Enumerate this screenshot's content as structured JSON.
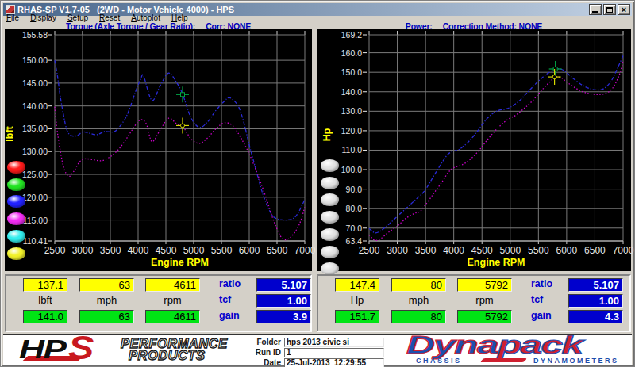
{
  "window": {
    "title": "RHAS-SP V1.7-05   (2WD - Motor Vehicle 4000) - HPS"
  },
  "menu": [
    "File",
    "Display",
    "Setup",
    "Reset",
    "Autoplot",
    "Help"
  ],
  "chart_data": [
    {
      "type": "line",
      "header": "Torque (Axle Torque / Gear Ratio):",
      "header_status": "Corr: NONE",
      "ylabel": "lbft",
      "xlabel": "Engine RPM",
      "xlim": [
        2500,
        7000
      ],
      "ylim": [
        110.41,
        155.58
      ],
      "x_ticks": [
        2500,
        3000,
        3500,
        4000,
        4500,
        5000,
        5500,
        6000,
        6500,
        7000
      ],
      "y_tick_values": [
        155.58,
        150,
        145,
        140,
        135,
        130,
        125,
        120,
        115,
        110.41
      ],
      "y_tick_labels": [
        "155.58",
        "150.00",
        "145.00",
        "140.00",
        "135.00",
        "130.00",
        "125.00",
        "120.00",
        "115.00",
        "110.41"
      ],
      "legend_colors": [
        "#ff1a1a",
        "#22e422",
        "#2222ff",
        "#f32df3",
        "#33eeee",
        "#f2f22a"
      ],
      "series": [
        {
          "name": "corrected-torque",
          "color": "#2a2ad8",
          "style": "dashdot",
          "points": [
            [
              2500,
              150.0
            ],
            [
              2550,
              146.5
            ],
            [
              2600,
              142.0
            ],
            [
              2700,
              135.5
            ],
            [
              2780,
              133.6
            ],
            [
              2900,
              133.5
            ],
            [
              3000,
              134.3
            ],
            [
              3100,
              134.1
            ],
            [
              3250,
              133.7
            ],
            [
              3400,
              134.4
            ],
            [
              3550,
              134.3
            ],
            [
              3650,
              135.2
            ],
            [
              3800,
              138.0
            ],
            [
              3950,
              143.0
            ],
            [
              4050,
              146.0
            ],
            [
              4100,
              146.5
            ],
            [
              4250,
              141.2
            ],
            [
              4400,
              144.5
            ],
            [
              4550,
              147.2
            ],
            [
              4700,
              145.0
            ],
            [
              4800,
              142.6
            ],
            [
              4950,
              137.5
            ],
            [
              5100,
              135.3
            ],
            [
              5250,
              136.5
            ],
            [
              5400,
              139.0
            ],
            [
              5550,
              141.0
            ],
            [
              5650,
              141.8
            ],
            [
              5800,
              140.0
            ],
            [
              5900,
              136.5
            ],
            [
              6000,
              131.5
            ],
            [
              6100,
              127.0
            ],
            [
              6250,
              120.5
            ],
            [
              6400,
              116.3
            ],
            [
              6500,
              115.3
            ],
            [
              6650,
              115.0
            ],
            [
              6800,
              115.4
            ],
            [
              6900,
              117.0
            ],
            [
              7000,
              119.5
            ]
          ]
        },
        {
          "name": "axle-torque",
          "color": "#cc00cc",
          "style": "dotted",
          "points": [
            [
              2500,
              139.8
            ],
            [
              2550,
              134.0
            ],
            [
              2650,
              127.0
            ],
            [
              2750,
              124.6
            ],
            [
              2850,
              125.8
            ],
            [
              2950,
              127.8
            ],
            [
              3050,
              128.4
            ],
            [
              3200,
              128.2
            ],
            [
              3350,
              128.0
            ],
            [
              3500,
              128.9
            ],
            [
              3650,
              130.5
            ],
            [
              3800,
              133.0
            ],
            [
              3950,
              135.8
            ],
            [
              4050,
              137.0
            ],
            [
              4150,
              136.0
            ],
            [
              4250,
              132.2
            ],
            [
              4400,
              134.8
            ],
            [
              4550,
              137.3
            ],
            [
              4700,
              136.0
            ],
            [
              4800,
              135.6
            ],
            [
              4950,
              132.8
            ],
            [
              5100,
              131.8
            ],
            [
              5250,
              133.0
            ],
            [
              5400,
              135.0
            ],
            [
              5550,
              136.3
            ],
            [
              5700,
              135.7
            ],
            [
              5850,
              133.0
            ],
            [
              6000,
              129.5
            ],
            [
              6150,
              125.0
            ],
            [
              6300,
              120.0
            ],
            [
              6450,
              114.5
            ],
            [
              6600,
              110.9
            ],
            [
              6750,
              111.3
            ],
            [
              6900,
              114.0
            ],
            [
              7000,
              117.8
            ]
          ]
        }
      ],
      "cursors": [
        {
          "name": "green-cursor",
          "color": "#00a546",
          "x": 4800,
          "y": 142.5,
          "shape": "square"
        },
        {
          "name": "yellow-cursor",
          "color": "#d8d800",
          "x": 4800,
          "y": 135.7,
          "shape": "circle"
        }
      ]
    },
    {
      "type": "line",
      "header": "Power:",
      "header_status": "Correction Method: NONE",
      "ylabel": "Hp",
      "xlabel": "Engine RPM",
      "xlim": [
        2500,
        7000
      ],
      "ylim": [
        63.4,
        169.2
      ],
      "x_ticks": [
        2500,
        3000,
        3500,
        4000,
        4500,
        5000,
        5500,
        6000,
        6500,
        7000
      ],
      "y_tick_values": [
        169.2,
        160,
        150,
        140,
        130,
        120,
        110,
        100,
        90,
        80,
        70,
        63.4
      ],
      "y_tick_labels": [
        "169.2",
        "160.0",
        "150.0",
        "140.0",
        "130.0",
        "120.0",
        "110.0",
        "100.0",
        "90.0",
        "80.0",
        "70.0",
        "63.4"
      ],
      "legend_colors": [
        "#e2e2e2",
        "#e2e2e2",
        "#e2e2e2",
        "#e2e2e2",
        "#e2e2e2",
        "#e2e2e2",
        "#e2e2e2"
      ],
      "series": [
        {
          "name": "corrected-power",
          "color": "#2a2ad8",
          "style": "dashdot",
          "points": [
            [
              2500,
              69.8
            ],
            [
              2600,
              67.6
            ],
            [
              2700,
              68.5
            ],
            [
              2850,
              72.0
            ],
            [
              3000,
              76.0
            ],
            [
              3150,
              80.0
            ],
            [
              3300,
              84.0
            ],
            [
              3450,
              88.0
            ],
            [
              3550,
              92.0
            ],
            [
              3650,
              97.0
            ],
            [
              3800,
              104.0
            ],
            [
              3900,
              108.0
            ],
            [
              4000,
              109.5
            ],
            [
              4100,
              110.5
            ],
            [
              4250,
              114.0
            ],
            [
              4400,
              119.0
            ],
            [
              4500,
              123.0
            ],
            [
              4600,
              126.5
            ],
            [
              4700,
              129.0
            ],
            [
              4800,
              130.5
            ],
            [
              4900,
              131.0
            ],
            [
              5000,
              132.0
            ],
            [
              5150,
              135.0
            ],
            [
              5300,
              139.5
            ],
            [
              5450,
              144.0
            ],
            [
              5600,
              148.0
            ],
            [
              5750,
              151.0
            ],
            [
              5850,
              151.8
            ],
            [
              5950,
              151.0
            ],
            [
              6050,
              148.5
            ],
            [
              6150,
              146.0
            ],
            [
              6300,
              143.0
            ],
            [
              6450,
              141.3
            ],
            [
              6600,
              141.0
            ],
            [
              6700,
              142.5
            ],
            [
              6800,
              146.0
            ],
            [
              6900,
              152.0
            ],
            [
              7000,
              158.5
            ]
          ]
        },
        {
          "name": "measured-power",
          "color": "#cc00cc",
          "style": "dotted",
          "points": [
            [
              2500,
              66.5
            ],
            [
              2600,
              63.8
            ],
            [
              2700,
              64.5
            ],
            [
              2850,
              68.0
            ],
            [
              3000,
              71.0
            ],
            [
              3150,
              75.0
            ],
            [
              3300,
              77.5
            ],
            [
              3400,
              78.5
            ],
            [
              3500,
              82.0
            ],
            [
              3650,
              88.0
            ],
            [
              3800,
              94.0
            ],
            [
              3900,
              98.5
            ],
            [
              4000,
              101.0
            ],
            [
              4150,
              102.5
            ],
            [
              4300,
              105.5
            ],
            [
              4450,
              110.0
            ],
            [
              4600,
              115.5
            ],
            [
              4750,
              120.5
            ],
            [
              4900,
              124.5
            ],
            [
              5000,
              126.5
            ],
            [
              5100,
              128.0
            ],
            [
              5250,
              131.5
            ],
            [
              5400,
              135.5
            ],
            [
              5550,
              140.5
            ],
            [
              5700,
              145.0
            ],
            [
              5800,
              147.6
            ],
            [
              5900,
              147.2
            ],
            [
              6000,
              145.0
            ],
            [
              6150,
              142.0
            ],
            [
              6300,
              139.8
            ],
            [
              6450,
              138.8
            ],
            [
              6600,
              138.6
            ],
            [
              6750,
              140.0
            ],
            [
              6850,
              143.5
            ],
            [
              6950,
              150.0
            ],
            [
              7000,
              156.0
            ]
          ]
        }
      ],
      "cursors": [
        {
          "name": "green-cursor",
          "color": "#00a546",
          "x": 5800,
          "y": 151.7,
          "shape": "square"
        },
        {
          "name": "yellow-cursor",
          "color": "#d8d800",
          "x": 5785,
          "y": 147.6,
          "shape": "circle"
        }
      ]
    }
  ],
  "readouts": [
    {
      "row1": [
        "137.1",
        "63",
        "4611"
      ],
      "units": [
        "lbft",
        "mph",
        "rpm"
      ],
      "row2": [
        "141.0",
        "63",
        "4611"
      ],
      "side": [
        {
          "label": "ratio",
          "value": "5.107"
        },
        {
          "label": "tcf",
          "value": "1.00"
        },
        {
          "label": "gain",
          "value": "3.9"
        }
      ]
    },
    {
      "row1": [
        "147.4",
        "80",
        "5792"
      ],
      "units": [
        "Hp",
        "mph",
        "rpm"
      ],
      "row2": [
        "151.7",
        "80",
        "5792"
      ],
      "side": [
        {
          "label": "ratio",
          "value": "5.107"
        },
        {
          "label": "tcf",
          "value": "1.00"
        },
        {
          "label": "gain",
          "value": "4.3"
        }
      ]
    }
  ],
  "footer": {
    "hps_text": {
      "hp": "HP",
      "s": "S",
      "line1": "PERFORMANCE",
      "line2": "PRODUCTS"
    },
    "fields": [
      {
        "label": "Folder",
        "value": "hps 2013 civic si"
      },
      {
        "label": "Run ID",
        "value": "1"
      },
      {
        "label": "Date",
        "value": "25-Jul-2013  12:29:55"
      }
    ],
    "dynapack": {
      "part1": "Dyna",
      "part2": "pack",
      "sub1": "CHASSIS",
      "sub2": "DYNAMOMETERS"
    }
  }
}
